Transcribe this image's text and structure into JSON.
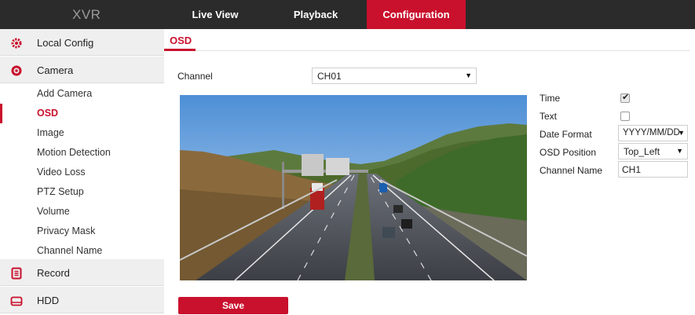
{
  "header": {
    "logo": "XVR",
    "tabs": [
      {
        "label": "Live View"
      },
      {
        "label": "Playback"
      },
      {
        "label": "Configuration"
      }
    ]
  },
  "sidebar": {
    "groups": [
      {
        "label": "Local Config",
        "icon": "gear-icon"
      },
      {
        "label": "Camera",
        "icon": "camera-icon"
      },
      {
        "label": "Record",
        "icon": "record-icon"
      },
      {
        "label": "HDD",
        "icon": "hdd-icon"
      }
    ],
    "camera_items": [
      {
        "label": "Add Camera"
      },
      {
        "label": "OSD"
      },
      {
        "label": "Image"
      },
      {
        "label": "Motion Detection"
      },
      {
        "label": "Video Loss"
      },
      {
        "label": "PTZ Setup"
      },
      {
        "label": "Volume"
      },
      {
        "label": "Privacy Mask"
      },
      {
        "label": "Channel Name"
      }
    ],
    "active_item": "OSD"
  },
  "main": {
    "title": "OSD",
    "channel_label": "Channel",
    "channel_value": "CH01",
    "settings": {
      "time_label": "Time",
      "time_checked": true,
      "text_label": "Text",
      "text_checked": false,
      "date_format_label": "Date Format",
      "date_format_value": "YYYY/MM/DD",
      "osd_position_label": "OSD Position",
      "osd_position_value": "Top_Left",
      "channel_name_label": "Channel Name",
      "channel_name_value": "CH1"
    },
    "save_label": "Save"
  },
  "colors": {
    "accent": "#c9102c",
    "topbar": "#2b2b2b",
    "sidebar_group": "#efefef"
  }
}
